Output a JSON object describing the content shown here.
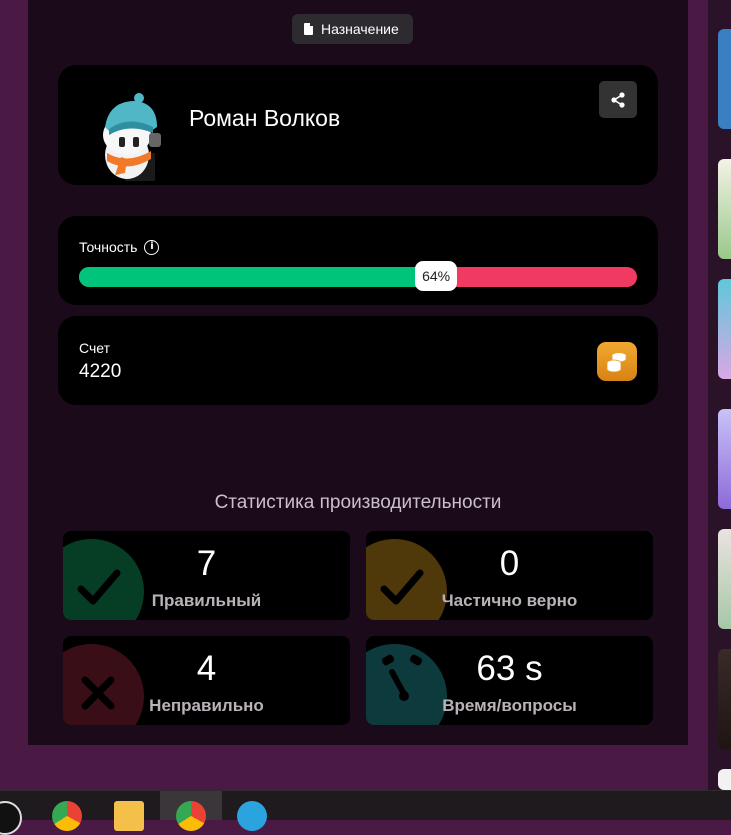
{
  "assignment_chip": {
    "label": "Назначение",
    "icon": "document-icon"
  },
  "profile": {
    "name": "Роман Волков",
    "avatar": "avatar-character",
    "share_icon": "share-icon"
  },
  "accuracy": {
    "label": "Точность",
    "percent": 64,
    "percent_label": "64%",
    "info_icon": "info-icon"
  },
  "score": {
    "label": "Счет",
    "value": "4220",
    "icon": "coins-icon"
  },
  "stats": {
    "title": "Статистика производительности",
    "items": [
      {
        "value": "7",
        "label": "Правильный",
        "icon": "check-icon",
        "color": "#053d25"
      },
      {
        "value": "0",
        "label": "Частично верно",
        "icon": "check-icon",
        "color": "#4f380a"
      },
      {
        "value": "4",
        "label": "Неправильно",
        "icon": "cross-icon",
        "color": "#3a0e17"
      },
      {
        "value": "63 s",
        "label": "Время/вопросы",
        "icon": "timer-icon",
        "color": "#0d3a3c"
      }
    ]
  },
  "colors": {
    "page_bg": "#4a1a45",
    "panel_bg": "#1b0a1a",
    "card_bg": "#000000",
    "correct": "#00c47a",
    "incorrect": "#f03a63",
    "coins": "#e89a22"
  }
}
